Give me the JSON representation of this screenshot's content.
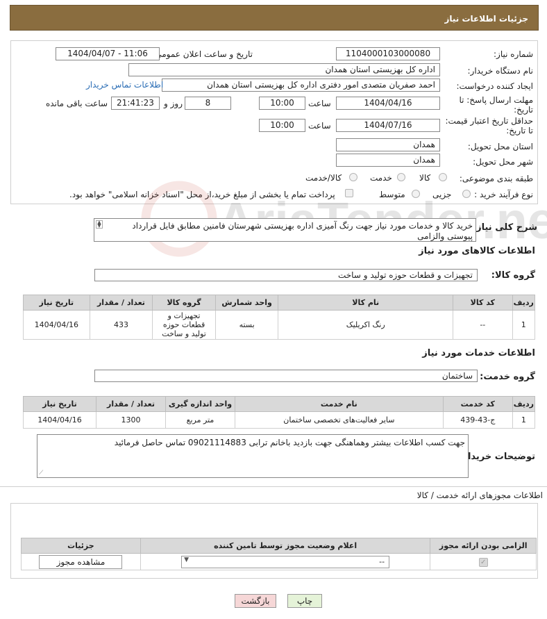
{
  "page": {
    "title": "جزئیات اطلاعات نیاز"
  },
  "form": {
    "need_number_label": "شماره نیاز:",
    "need_number": "1104000103000080",
    "announce_label": "تاریخ و ساعت اعلان عمومی:",
    "announce_value": "1404/04/07 - 11:06",
    "buyer_org_label": "نام دستگاه خریدار:",
    "buyer_org": "اداره کل بهزیستی استان همدان",
    "creator_label": "ایجاد کننده درخواست:",
    "creator": "احمد صفریان متصدی امور دفتری اداره کل بهزیستی استان همدان",
    "contact_link": "اطلاعات تماس خریدار",
    "deadline_label": "مهلت ارسال پاسخ: تا تاریخ:",
    "deadline_date": "1404/04/16",
    "time_label": "ساعت",
    "deadline_time": "10:00",
    "days_value": "8",
    "days_label": "روز و",
    "remaining_time": "21:41:23",
    "remaining_label": "ساعت باقی مانده",
    "validity_label": "حداقل تاریخ اعتبار قیمت: تا تاریخ:",
    "validity_date": "1404/07/16",
    "validity_time": "10:00",
    "province_label": "استان محل تحویل:",
    "province": "همدان",
    "city_label": "شهر محل تحویل:",
    "city": "همدان",
    "category_label": "طبقه بندی موضوعی:",
    "category_options": [
      "کالا",
      "خدمت",
      "کالا/خدمت"
    ],
    "process_label": "نوع فرآیند خرید :",
    "process_options": [
      "جزیی",
      "متوسط"
    ],
    "payment_note": "پرداخت تمام یا بخشی از مبلغ خرید،از محل \"اسناد خزانه اسلامی\" خواهد بود."
  },
  "description": {
    "label": "شرح کلی نیاز:",
    "text": "خرید کالا و خدمات مورد نیاز جهت رنگ آمیزی اداره بهزیستی شهرستان فامنین مطابق فایل قرارداد پیوستی والزامی"
  },
  "goods": {
    "section_title": "اطلاعات کالاهای مورد نیاز",
    "group_label": "گروه کالا:",
    "group_value": "تجهیزات و قطعات حوزه تولید و ساخت",
    "headers": [
      "ردیف",
      "کد کالا",
      "نام کالا",
      "واحد شمارش",
      "گروه کالا",
      "تعداد / مقدار",
      "تاریخ نیاز"
    ],
    "rows": [
      [
        "1",
        "--",
        "رنگ اکریلیک",
        "بسته",
        "تجهیزات و قطعات حوزه تولید و ساخت",
        "433",
        "1404/04/16"
      ]
    ]
  },
  "services": {
    "section_title": "اطلاعات خدمات مورد نیاز",
    "group_label": "گروه خدمت:",
    "group_value": "ساختمان",
    "headers": [
      "ردیف",
      "کد خدمت",
      "نام خدمت",
      "واحد اندازه گیری",
      "تعداد / مقدار",
      "تاریخ نیاز"
    ],
    "rows": [
      [
        "1",
        "ج-43-439",
        "سایر فعالیت‌های تخصصی ساختمان",
        "متر مربع",
        "1300",
        "1404/04/16"
      ]
    ]
  },
  "buyer_notes": {
    "label": "توضیحات خریدار:",
    "text": "جهت کسب اطلاعات بیشتر وهماهنگی جهت بازدید باخانم ترابی 09021114883 تماس حاصل فرمائید"
  },
  "permits": {
    "title": "اطلاعات مجوزهای ارائه خدمت / کالا",
    "headers": [
      "الزامی بودن ارائه مجوز",
      "اعلام وضعیت مجوز توسط تامین کننده",
      "جزئیات"
    ],
    "select_value": "--",
    "view_button": "مشاهده مجوز"
  },
  "actions": {
    "print": "چاپ",
    "back": "بازگشت"
  },
  "watermark": {
    "text": "AriaTender.net"
  },
  "colors": {
    "header_bg": "#8a6d3f",
    "back_button_bg": "#f6d7d7",
    "print_button_bg": "#e5f3d8",
    "link": "#2a6db5"
  }
}
